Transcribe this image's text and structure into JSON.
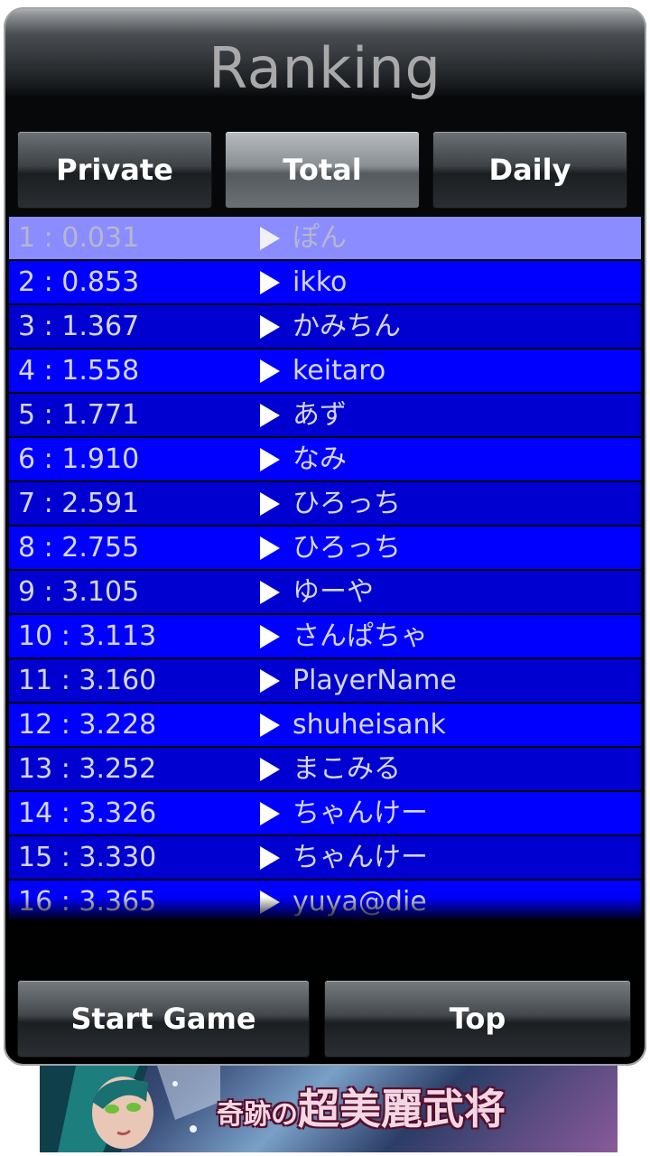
{
  "title": "Ranking",
  "tabs": [
    {
      "label": "Private",
      "active": false
    },
    {
      "label": "Total",
      "active": true
    },
    {
      "label": "Daily",
      "active": false
    }
  ],
  "ranking": [
    {
      "rank_time": "1 : 0.031",
      "name": "ぽん"
    },
    {
      "rank_time": "2 : 0.853",
      "name": "ikko"
    },
    {
      "rank_time": "3 : 1.367",
      "name": "かみちん"
    },
    {
      "rank_time": "4 : 1.558",
      "name": "keitaro"
    },
    {
      "rank_time": "5 : 1.771",
      "name": "あず"
    },
    {
      "rank_time": "6 : 1.910",
      "name": "なみ"
    },
    {
      "rank_time": "7 : 2.591",
      "name": "ひろっち"
    },
    {
      "rank_time": "8 : 2.755",
      "name": "ひろっち"
    },
    {
      "rank_time": "9 : 3.105",
      "name": "ゆーや"
    },
    {
      "rank_time": "10 : 3.113",
      "name": "さんぱちゃ"
    },
    {
      "rank_time": "11 : 3.160",
      "name": "PlayerName"
    },
    {
      "rank_time": "12 : 3.228",
      "name": "shuheisank"
    },
    {
      "rank_time": "13 : 3.252",
      "name": "まこみる"
    },
    {
      "rank_time": "14 : 3.326",
      "name": "ちゃんけー"
    },
    {
      "rank_time": "15 : 3.330",
      "name": "ちゃんけー"
    },
    {
      "rank_time": "16 : 3.365",
      "name": "yuya@die"
    }
  ],
  "buttons": {
    "start": "Start Game",
    "top": "Top"
  },
  "ad": {
    "text_prefix": "奇跡の",
    "text_main": "超美麗武将"
  },
  "colors": {
    "row_selected": "#8a8cff",
    "row_light": "#0000ff",
    "row_dark": "#0000d0",
    "play_icon": "#ffffff"
  }
}
